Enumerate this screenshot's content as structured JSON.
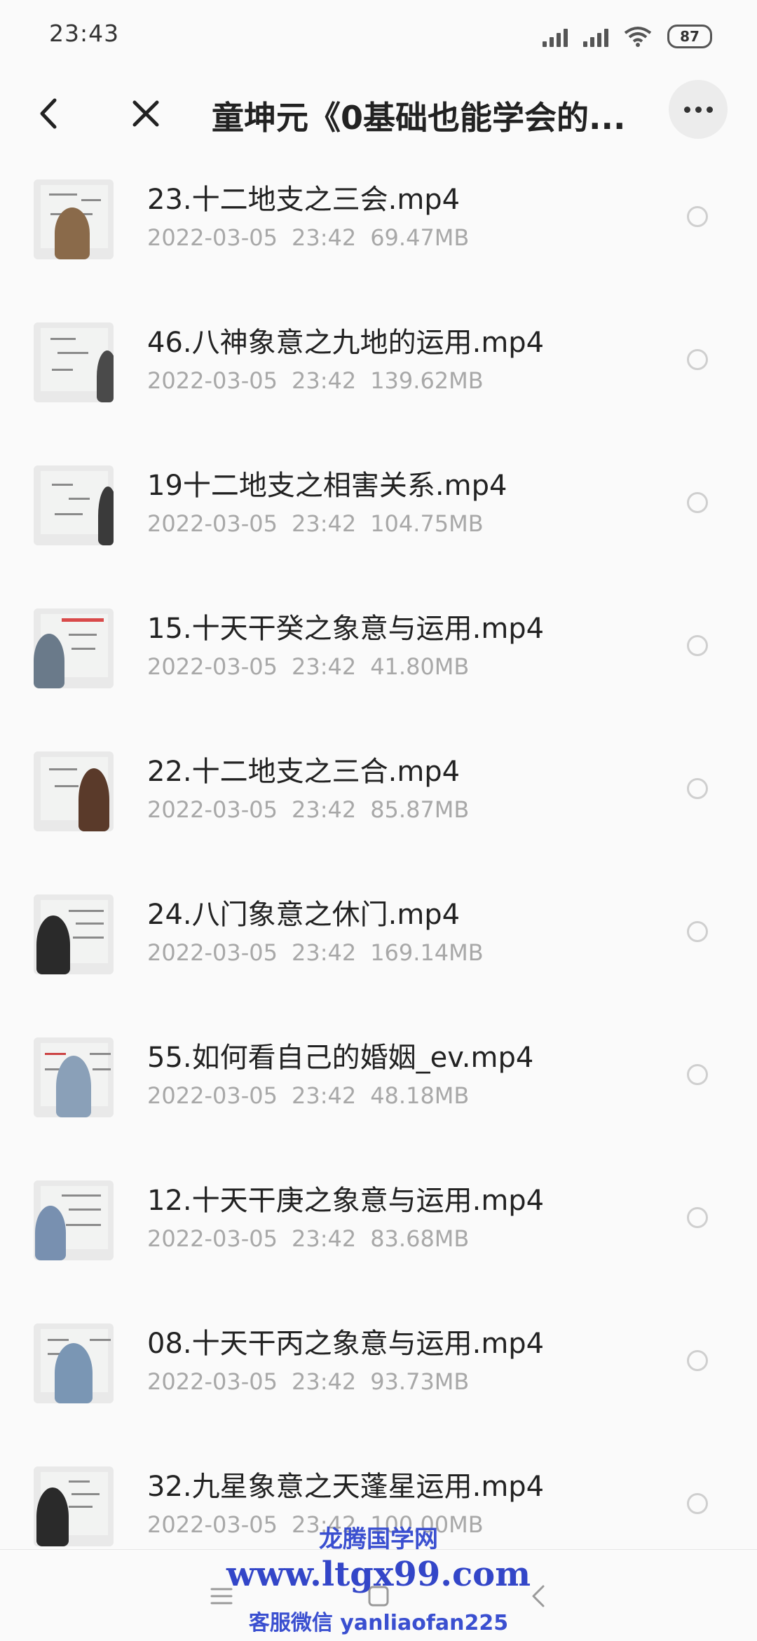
{
  "status_bar": {
    "time": "23:43",
    "battery": "87"
  },
  "header": {
    "title": "童坤元《0基础也能学会的..."
  },
  "files": [
    {
      "name": "23.十二地支之三会.mp4",
      "date": "2022-03-05",
      "time": "23:42",
      "size": "69.47MB"
    },
    {
      "name": "46.八神象意之九地的运用.mp4",
      "date": "2022-03-05",
      "time": "23:42",
      "size": "139.62MB"
    },
    {
      "name": "19十二地支之相害关系.mp4",
      "date": "2022-03-05",
      "time": "23:42",
      "size": "104.75MB"
    },
    {
      "name": "15.十天干癸之象意与运用.mp4",
      "date": "2022-03-05",
      "time": "23:42",
      "size": "41.80MB"
    },
    {
      "name": "22.十二地支之三合.mp4",
      "date": "2022-03-05",
      "time": "23:42",
      "size": "85.87MB"
    },
    {
      "name": "24.八门象意之休门.mp4",
      "date": "2022-03-05",
      "time": "23:42",
      "size": "169.14MB"
    },
    {
      "name": "55.如何看自己的婚姻_ev.mp4",
      "date": "2022-03-05",
      "time": "23:42",
      "size": "48.18MB"
    },
    {
      "name": "12.十天干庚之象意与运用.mp4",
      "date": "2022-03-05",
      "time": "23:42",
      "size": "83.68MB"
    },
    {
      "name": "08.十天干丙之象意与运用.mp4",
      "date": "2022-03-05",
      "time": "23:42",
      "size": "93.73MB"
    },
    {
      "name": "32.九星象意之天蓬星运用.mp4",
      "date": "2022-03-05",
      "time": "23:42",
      "size": "100.00MB"
    }
  ],
  "watermark": {
    "line1": "龙腾国学网",
    "line2": "www.ltgx99.com",
    "line3": "客服微信 yanliaofan225"
  },
  "icons": {
    "back": "chevron-left-icon",
    "close": "close-icon",
    "more": "more-dots-icon",
    "nav_menu": "menu-icon",
    "nav_home": "home-icon",
    "nav_back": "nav-back-icon"
  }
}
